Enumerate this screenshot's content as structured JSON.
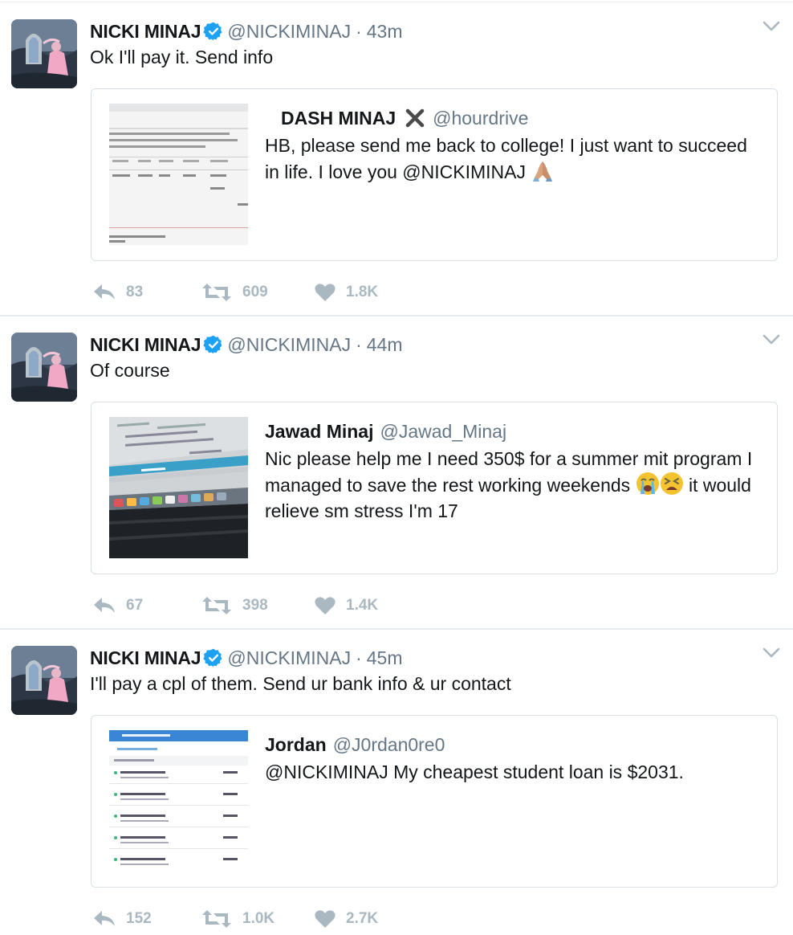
{
  "tweets": [
    {
      "name": "NICKI MINAJ",
      "handle": "@NICKIMINAJ",
      "separator": "·",
      "time": "43m",
      "text": "Ok I'll pay it. Send info",
      "quote": {
        "name": "DASH MINAJ",
        "handle": "@hourdrive",
        "text": "HB, please send me back to college! I just want to succeed in life. I love you @NICKIMINAJ"
      },
      "replies": "83",
      "retweets": "609",
      "likes": "1.8K"
    },
    {
      "name": "NICKI MINAJ",
      "handle": "@NICKIMINAJ",
      "separator": "·",
      "time": "44m",
      "text": "Of course",
      "quote": {
        "name": "Jawad Minaj",
        "handle": "@Jawad_Minaj",
        "text_a": "Nic please help me I need 350$ for a summer mit program I managed to save the rest working weekends",
        "text_b": "it would relieve sm stress I'm 17"
      },
      "replies": "67",
      "retweets": "398",
      "likes": "1.4K"
    },
    {
      "name": "NICKI MINAJ",
      "handle": "@NICKIMINAJ",
      "separator": "·",
      "time": "45m",
      "text": "I'll pay a cpl of them. Send ur bank info & ur contact",
      "quote": {
        "name": "Jordan",
        "handle": "@J0rdan0re0",
        "text": "@NICKIMINAJ My cheapest student loan is $2031."
      },
      "replies": "152",
      "retweets": "1.0K",
      "likes": "2.7K"
    }
  ],
  "colors": {
    "text": "#14171a",
    "secondary": "#657786",
    "action": "#aab8c2",
    "verified": "#1da1f2",
    "border": "#e6ecf0"
  },
  "icons": [
    "verified-badge-icon",
    "chevron-down-icon",
    "reply-icon",
    "retweet-icon",
    "heart-icon",
    "folded-hands-emoji",
    "x-mark-emoji",
    "crying-face-emoji",
    "tired-face-emoji"
  ]
}
